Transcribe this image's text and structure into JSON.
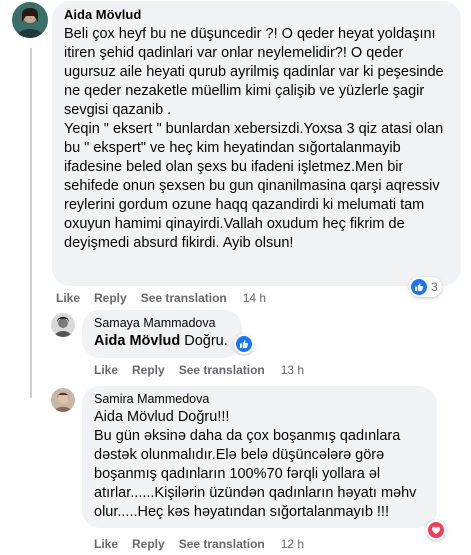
{
  "comment1": {
    "author": "Aida Mövlud",
    "text": "Beli çox heyf bu ne düşuncedir ?! O qeder heyat yoldaşını itiren şehid qadinlari var onlar neylemelidir?! O qeder ugursuz aile heyati qurub ayrilmiş qadinlar var ki peşesinde ne qeder nezaketle müellim kimi çalişib ve yüzlerle şagir sevgisi qazanib .\nYeqin \" eksert \" bunlardan xebersizdi.Yoxsa 3 qiz atasi olan bu \" ekspert\" ve heç kim heyatindan sığortalanmayib ifadesine beled olan şexs bu ifadeni işletmez.Men bir sehifede onun şexsen bu gun qinanilmasina qarşi aqressiv reylerini gordum ozune haqq qazandirdi ki melumati tam oxuyun hamimi qinayirdi.Vallah oxudum heç fikrim de deyişmedi absurd fikirdi. Ayib olsun!",
    "actions": {
      "like": "Like",
      "reply": "Reply",
      "see_translation": "See translation",
      "time": "14 h"
    },
    "reaction_count": "3",
    "reaction_icon": "like-icon"
  },
  "reply1": {
    "author": "Samaya Mammadova",
    "mention": "Aida Mövlud",
    "text": " Doğru.",
    "actions": {
      "like": "Like",
      "reply": "Reply",
      "see_translation": "See translation",
      "time": "13 h"
    },
    "reaction_icon": "like-icon"
  },
  "reply2": {
    "author": "Samira Mammedova",
    "mention": "Aida Mövlud",
    "text_after_mention": " Doğru!!!",
    "text": "Bu gün əksinə daha da çox boşanmış qadınlara dəstək olunmalıdır.Elə belə düşüncələrə görə boşanmış qadınların 100%70 fərqli yollara əl atırlar......Kişilərin üzündən qadınların həyatı məhv olur.....Heç kəs həyatından sığortalanmayıb !!!",
    "actions": {
      "like": "Like",
      "reply": "Reply",
      "see_translation": "See translation",
      "time": "12 h"
    },
    "reaction_icon": "love-icon"
  },
  "colors": {
    "bubble": "#f0f2f5",
    "meta": "#65676b",
    "like_blue": "#1877f2",
    "love_red": "#f33e58"
  }
}
